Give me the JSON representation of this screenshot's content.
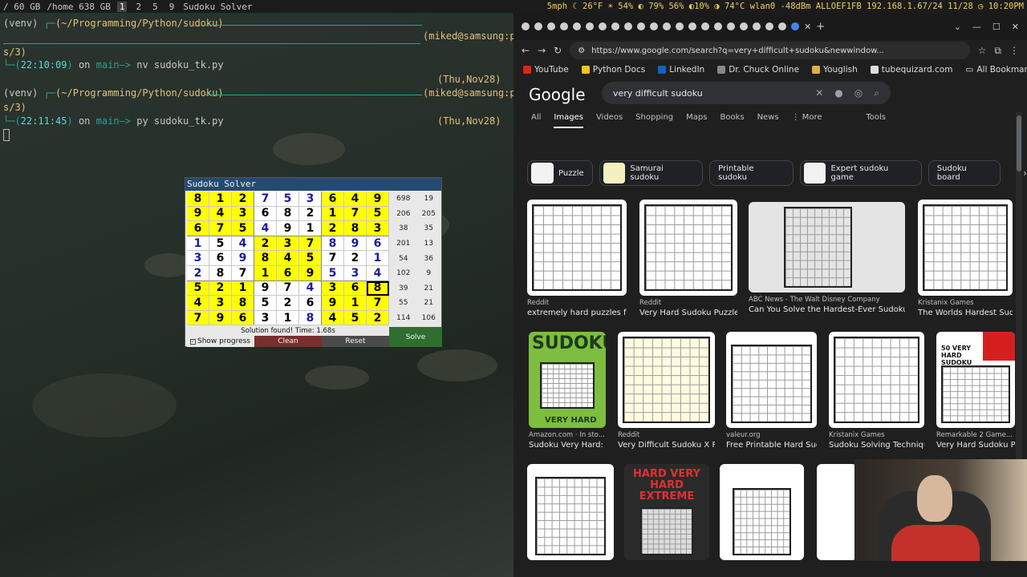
{
  "topbar": {
    "left": [
      "/ 60 GB",
      "/home 638 GB"
    ],
    "workspaces": [
      "1",
      "2",
      "5",
      "9"
    ],
    "window_title": "Sudoku Solver",
    "right": "5mph ☾ 26°F ☀ 54% ◐ 79% 56% ◐10% ◑ 74°C wlan0 -48dBm ALLOEF1FB 192.168.1.67/24 11/28 ◷ 10:20PM"
  },
  "terminal": {
    "line1_venv": "(venv)",
    "line1_path": "(~/Programming/Python/sudoku)",
    "line1_user": "(miked@samsung:pt",
    "line2": "s/3)",
    "line3_time": "22:10:09",
    "line3_branch": "main",
    "line3_cmd": "nv sudoku_tk.py",
    "line3_date": "(Thu,Nov28)",
    "line4_venv": "(venv)",
    "line4_path": "(~/Programming/Python/sudoku)",
    "line4_user": "(miked@samsung:pt",
    "line5": "s/3)",
    "line6_time": "22:11:45",
    "line6_branch": "main",
    "line6_cmd": "py sudoku_tk.py",
    "line6_date": "(Thu,Nov28)",
    "on_word": "on",
    "arrow": "—>"
  },
  "sudoku": {
    "title": "Sudoku Solver",
    "grid": [
      [
        8,
        1,
        2,
        7,
        5,
        3,
        6,
        4,
        9
      ],
      [
        9,
        4,
        3,
        6,
        8,
        2,
        1,
        7,
        5
      ],
      [
        6,
        7,
        5,
        4,
        9,
        1,
        2,
        8,
        3
      ],
      [
        1,
        5,
        4,
        2,
        3,
        7,
        8,
        9,
        6
      ],
      [
        3,
        6,
        9,
        8,
        4,
        5,
        7,
        2,
        1
      ],
      [
        2,
        8,
        7,
        1,
        6,
        9,
        5,
        3,
        4
      ],
      [
        5,
        2,
        1,
        9,
        7,
        4,
        3,
        6,
        8
      ],
      [
        4,
        3,
        8,
        5,
        2,
        6,
        9,
        1,
        7
      ],
      [
        7,
        9,
        6,
        3,
        1,
        8,
        4,
        5,
        2
      ]
    ],
    "given": [
      [
        1,
        1,
        1,
        0,
        0,
        0,
        1,
        1,
        1
      ],
      [
        1,
        1,
        1,
        0,
        0,
        0,
        1,
        1,
        1
      ],
      [
        1,
        1,
        1,
        0,
        0,
        0,
        1,
        1,
        1
      ],
      [
        0,
        0,
        0,
        1,
        1,
        1,
        0,
        0,
        0
      ],
      [
        0,
        0,
        0,
        1,
        1,
        1,
        0,
        0,
        0
      ],
      [
        0,
        0,
        0,
        1,
        1,
        1,
        0,
        0,
        0
      ],
      [
        1,
        1,
        1,
        0,
        0,
        0,
        1,
        1,
        1
      ],
      [
        1,
        1,
        1,
        0,
        0,
        0,
        1,
        1,
        1
      ],
      [
        1,
        1,
        1,
        0,
        0,
        0,
        1,
        1,
        1
      ]
    ],
    "black_cells": [
      [
        1,
        3
      ],
      [
        1,
        4
      ],
      [
        2,
        4
      ],
      [
        3,
        1
      ],
      [
        4,
        6
      ],
      [
        5,
        1
      ],
      [
        5,
        2
      ],
      [
        6,
        3
      ],
      [
        6,
        4
      ],
      [
        7,
        3
      ],
      [
        7,
        4
      ],
      [
        7,
        5
      ],
      [
        8,
        3
      ],
      [
        8,
        4
      ],
      [
        2,
        5
      ],
      [
        4,
        1
      ],
      [
        4,
        7
      ],
      [
        1,
        5
      ]
    ],
    "selected": [
      6,
      8
    ],
    "stats": [
      [
        "698",
        "19"
      ],
      [
        "206",
        "205"
      ],
      [
        "38",
        "35"
      ],
      [
        "201",
        "13"
      ],
      [
        "54",
        "36"
      ],
      [
        "102",
        "9"
      ],
      [
        "39",
        "21"
      ],
      [
        "55",
        "21"
      ],
      [
        "114",
        "106"
      ]
    ],
    "status": "Solution found! Time: 1.68s",
    "show_progress_label": "Show progress",
    "clean_label": "Clean",
    "reset_label": "Reset",
    "solve_label": "Solve",
    "colors": {
      "given_bg": "#ffff00",
      "solved_fg": "#1a1aa0"
    }
  },
  "browser": {
    "url": "https://www.google.com/search?q=very+difficult+sudoku&newwindow...",
    "bookmarks": [
      "YouTube",
      "Python Docs",
      "LinkedIn",
      "Dr. Chuck Online",
      "Youglish",
      "tubequizard.com"
    ],
    "all_bookmarks": "All Bookmarks",
    "logo": "Google",
    "query": "very difficult sudoku",
    "tabs": [
      "All",
      "Images",
      "Videos",
      "Shopping",
      "Maps",
      "Books",
      "News",
      "More"
    ],
    "tools": "Tools",
    "chips": [
      "Puzzle",
      "Samurai sudoku",
      "Printable sudoku",
      "Expert sudoku game",
      "Sudoku board"
    ],
    "results_row1": [
      {
        "source": "Reddit",
        "caption": "extremely hard puzzles fro..."
      },
      {
        "source": "Reddit",
        "caption": "Very Hard Sudoku Puzzle : ..."
      },
      {
        "source": "ABC News - The Walt Disney Company",
        "caption": "Can You Solve the Hardest-Ever Sudoku ..."
      },
      {
        "source": "Kristanix Games",
        "caption": "The Worlds Hardest Sudo..."
      }
    ],
    "results_row2": [
      {
        "source": "Amazon.com · In sto...",
        "caption": "Sudoku Very Hard: S..."
      },
      {
        "source": "Reddit",
        "caption": "Very Difficult Sudoku X P..."
      },
      {
        "source": "valeur.org",
        "caption": "Free Printable Hard Sud..."
      },
      {
        "source": "Kristanix Games",
        "caption": "Sudoku Solving Techniques"
      },
      {
        "source": "Remarkable 2 Game...",
        "caption": "Very Hard Sudoku P..."
      }
    ],
    "thumb_text": {
      "sudoku_book": "SUDOKU",
      "very_hard": "VERY HARD",
      "hard_extreme": "HARD VERY HARD EXTREME",
      "fifty": "50 VERY HARD SUDOKU"
    }
  }
}
